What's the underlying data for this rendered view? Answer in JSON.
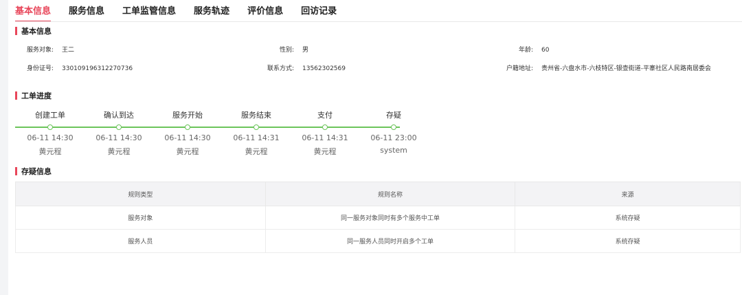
{
  "tabs": [
    "基本信息",
    "服务信息",
    "工单监管信息",
    "服务轨迹",
    "评价信息",
    "回访记录"
  ],
  "sections": {
    "basic": "基本信息",
    "progress": "工单进度",
    "suspect": "存疑信息"
  },
  "basic": {
    "service_object_label": "服务对象:",
    "service_object": "王二",
    "gender_label": "性别:",
    "gender": "男",
    "age_label": "年龄:",
    "age": "60",
    "id_label": "身份证号:",
    "id": "330109196312270736",
    "phone_label": "联系方式:",
    "phone": "13562302569",
    "address_label": "户籍地址:",
    "address": "贵州省-六盘水市-六枝特区-银壶街道-平寨社区人民路南居委会"
  },
  "progress": {
    "steps": [
      {
        "name": "创建工单",
        "time": "06-11 14:30",
        "user": "黄元程"
      },
      {
        "name": "确认到达",
        "time": "06-11 14:30",
        "user": "黄元程"
      },
      {
        "name": "服务开始",
        "time": "06-11 14:30",
        "user": "黄元程"
      },
      {
        "name": "服务结束",
        "time": "06-11 14:31",
        "user": "黄元程"
      },
      {
        "name": "支付",
        "time": "06-11 14:31",
        "user": "黄元程"
      },
      {
        "name": "存疑",
        "time": "06-11 23:00",
        "user": "system"
      }
    ]
  },
  "suspect": {
    "columns": [
      "规则类型",
      "规则名称",
      "来源"
    ],
    "rows": [
      [
        "服务对象",
        "同一服务对象同时有多个服务中工单",
        "系统存疑"
      ],
      [
        "服务人员",
        "同一服务人员同时开启多个工单",
        "系统存疑"
      ]
    ]
  },
  "colors": {
    "accent": "#e8465a",
    "progress": "#6bc45a"
  }
}
